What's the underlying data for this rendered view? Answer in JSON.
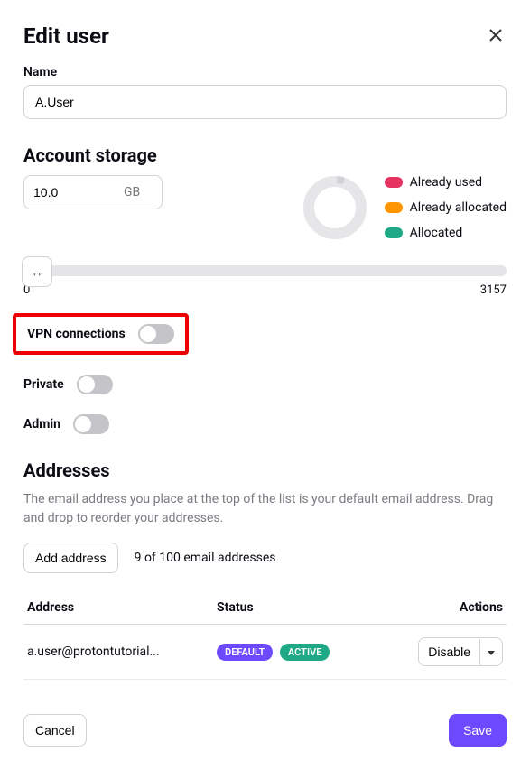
{
  "header": {
    "title": "Edit user"
  },
  "name": {
    "label": "Name",
    "value": "A.User"
  },
  "storage": {
    "title": "Account storage",
    "value": "10.0",
    "unit": "GB",
    "slider": {
      "min": "0",
      "max": "3157",
      "thumb": "↔"
    },
    "legend": [
      {
        "label": "Already used",
        "color": "#e5325f"
      },
      {
        "label": "Already allocated",
        "color": "#ff9500"
      },
      {
        "label": "Allocated",
        "color": "#1ea885"
      }
    ]
  },
  "toggles": {
    "vpn": {
      "label": "VPN connections"
    },
    "private": {
      "label": "Private"
    },
    "admin": {
      "label": "Admin"
    }
  },
  "addresses": {
    "title": "Addresses",
    "description": "The email address you place at the top of the list is your default email address. Drag and drop to reorder your addresses.",
    "add_button": "Add address",
    "count": "9 of 100 email addresses",
    "columns": {
      "address": "Address",
      "status": "Status",
      "actions": "Actions"
    },
    "rows": [
      {
        "address": "a.user@protontutorial...",
        "badges": {
          "default": "DEFAULT",
          "active": "ACTIVE"
        },
        "action": "Disable"
      }
    ]
  },
  "footer": {
    "cancel": "Cancel",
    "save": "Save"
  }
}
